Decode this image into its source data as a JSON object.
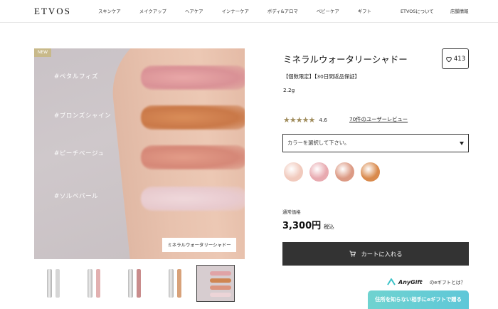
{
  "header": {
    "logo": "ETVOS",
    "nav": [
      "スキンケア",
      "メイクアップ",
      "ヘアケア",
      "インナーケア",
      "ボディ&アロマ",
      "ベビーケア",
      "ギフト"
    ],
    "about": "ETVOSについて",
    "stores": "店舗情報"
  },
  "gallery": {
    "badge": "NEW",
    "labels": [
      "#ペタルフィズ",
      "#ブロンズシャイン",
      "#ピーチベージュ",
      "#ソルベパール"
    ],
    "caption": "ミネラルウォータリーシャドー",
    "thumb_caps": [
      "#c9c9c9",
      "#e2b0b0",
      "#c98c8c",
      "#d8a27a"
    ]
  },
  "product": {
    "title": "ミネラルウォータリーシャドー",
    "favorites": "413",
    "tags": "【個数限定】【30日間返品保証】",
    "volume": "2.2g",
    "stars": "★★★★★",
    "rating": "4.6",
    "reviews_link": "70件のユーザーレビュー",
    "select_placeholder": "カラーを選択して下さい。",
    "swatch_colors": [
      "#f1cabd",
      "#e8aab0",
      "#dc9a84",
      "#d98a4d"
    ],
    "price_label": "通常価格",
    "price": "3,300円",
    "tax": "税込",
    "cart_label": "カートに入れる"
  },
  "gift": {
    "logo": "AnyGift",
    "question": "のeギフトとは？",
    "button": "住所を知らない相手にeギフトで贈る"
  }
}
